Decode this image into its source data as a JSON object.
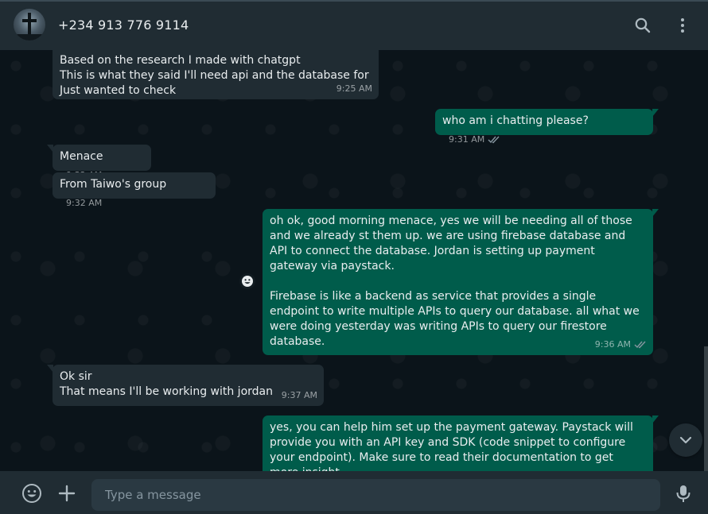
{
  "header": {
    "contact_name": "+234 913 776 9114",
    "avatar_icon": "cross-silhouette",
    "search_icon": "search-icon",
    "menu_icon": "kebab-menu-icon"
  },
  "messages": [
    {
      "direction": "in",
      "lines": "Based on the research I made with chatgpt\nThis is what they said I'll need api and the database for\nJust wanted to check",
      "time": "9:25 AM"
    },
    {
      "direction": "out",
      "lines": "who am i chatting please?",
      "time": "9:31 AM",
      "status": "read"
    },
    {
      "direction": "in",
      "lines": "Menace",
      "time": "9:32 AM"
    },
    {
      "direction": "in",
      "lines": "From Taiwo's group",
      "time": "9:32 AM"
    },
    {
      "direction": "out",
      "lines": "oh ok, good morning menace, yes we will be needing all of those\nand we already st them up. we are using firebase database and\nAPI to connect the database. Jordan is setting up payment\ngateway via paystack.\n\nFirebase is like a backend as service that provides a single\nendpoint to write multiple APIs to query our database. all what we\nwere doing yesterday was writing APIs to query our firestore\ndatabase.",
      "time": "9:36 AM",
      "status": "read"
    },
    {
      "direction": "in",
      "lines": "Ok sir\nThat means I'll be working with jordan",
      "time": "9:37 AM"
    },
    {
      "direction": "out",
      "lines": "yes, you can help him set up the payment gateway. Paystack will\nprovide you with an API key and SDK (code snippet to configure\nyour endpoint). Make sure to read their documentation to get\nmore insight."
    }
  ],
  "composer": {
    "placeholder": "Type a message",
    "value": ""
  },
  "colors": {
    "header_bg": "#202c33",
    "chat_bg": "#0b141a",
    "incoming_bubble": "#202c33",
    "outgoing_bubble": "#005c4b",
    "read_ticks": "#8696a0"
  }
}
